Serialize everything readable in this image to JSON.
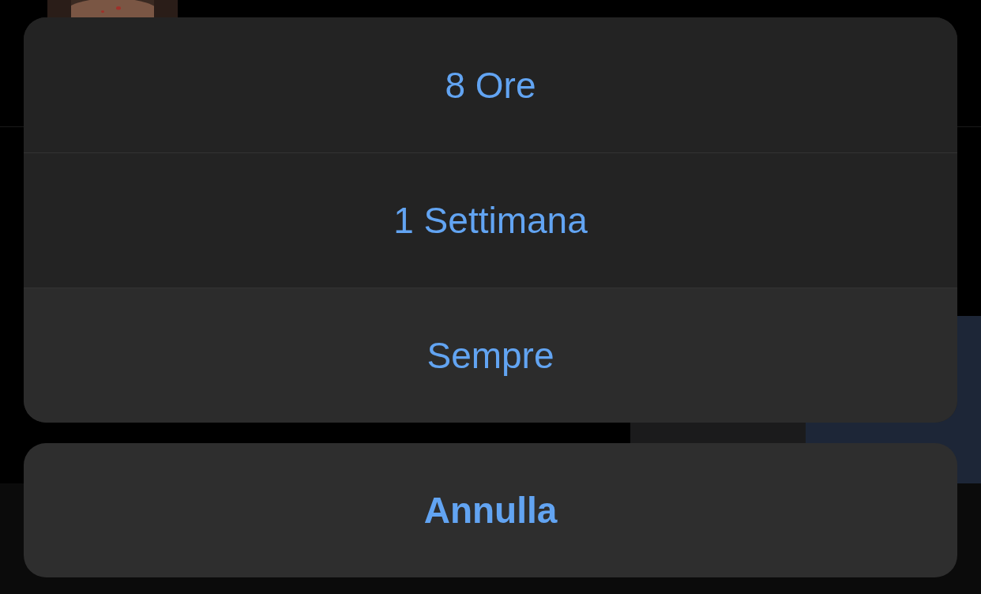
{
  "action_sheet": {
    "options": [
      {
        "label": "8 Ore"
      },
      {
        "label": "1 Settimana"
      },
      {
        "label": "Sempre"
      }
    ],
    "cancel": "Annulla"
  }
}
